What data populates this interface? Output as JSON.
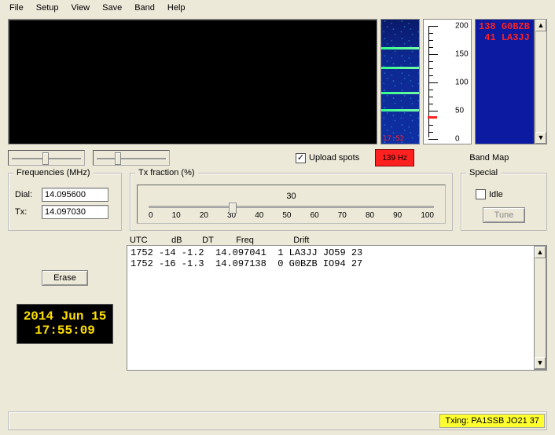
{
  "menu": {
    "file": "File",
    "setup": "Setup",
    "view": "View",
    "save": "Save",
    "band": "Band",
    "help": "Help"
  },
  "spectrum": {
    "timestamp": "17:52",
    "bands_pct_from_top": [
      22,
      38,
      58,
      72
    ]
  },
  "scale": {
    "ticks": [
      "200",
      "150",
      "100",
      "50",
      "0"
    ],
    "red_marker_value": 40
  },
  "bandmap": {
    "label": "Band Map",
    "entries": [
      {
        "freq_offset": "138",
        "call": "G0BZB"
      },
      {
        "freq_offset": " 41",
        "call": "LA3JJ"
      }
    ]
  },
  "sliders": {
    "s1_pos_pct": 50,
    "s2_pos_pct": 30
  },
  "upload_spots": {
    "label": "Upload spots",
    "checked": true
  },
  "hz_indicator": "139 Hz",
  "frequencies": {
    "legend": "Frequencies (MHz)",
    "dial_label": "Dial:",
    "dial_value": "14.095600",
    "tx_label": "Tx:",
    "tx_value": "14.097030"
  },
  "tx_fraction": {
    "legend": "Tx fraction (%)",
    "value": "30",
    "ticks": [
      "0",
      "10",
      "20",
      "30",
      "40",
      "50",
      "60",
      "70",
      "80",
      "90",
      "100"
    ],
    "pos_pct": 30
  },
  "special": {
    "legend": "Special",
    "idle_label": "Idle",
    "idle_checked": false,
    "tune_label": "Tune"
  },
  "erase_label": "Erase",
  "clock": {
    "date": "2014 Jun 15",
    "time": "17:55:09"
  },
  "decode_header": {
    "utc": "UTC",
    "db": "dB",
    "dt": "DT",
    "freq": "Freq",
    "drift": "Drift"
  },
  "decodes": [
    "1752 -14 -1.2  14.097041  1 LA3JJ JO59 23",
    "1752 -16 -1.3  14.097138  0 G0BZB IO94 27"
  ],
  "status": {
    "txing": "Txing: PA1SSB JO21 37"
  }
}
